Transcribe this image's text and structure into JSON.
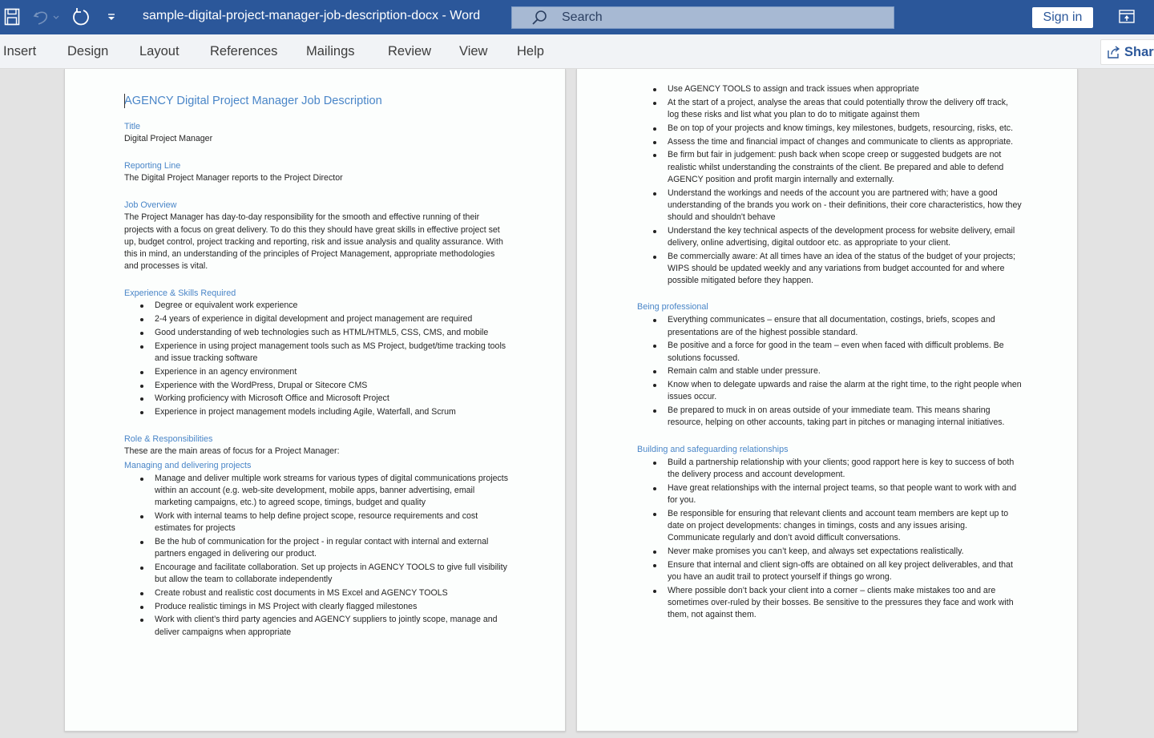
{
  "titlebar": {
    "document_title": "sample-digital-project-manager-job-description-docx  -  Word",
    "search_placeholder": "Search",
    "sign_in_label": "Sign in",
    "colors": {
      "titlebar": "#2b579a",
      "heading": "#4a86c8"
    }
  },
  "ribbon": {
    "tabs": [
      "Insert",
      "Design",
      "Layout",
      "References",
      "Mailings",
      "Review",
      "View",
      "Help"
    ],
    "share_label": "Share"
  },
  "document": {
    "title": "AGENCY Digital Project Manager Job Description",
    "title_section": {
      "heading": "Title",
      "text": "Digital Project Manager"
    },
    "reporting_line": {
      "heading": "Reporting Line",
      "text": "The Digital Project Manager reports to the Project Director"
    },
    "job_overview": {
      "heading": "Job Overview",
      "text": "The Project Manager has day-to-day responsibility for the smooth and effective running of their projects with a focus on great delivery. To do this they should have great skills in effective project set up, budget control, project tracking and reporting, risk and issue analysis and quality assurance. With this in mind, an understanding of the principles of Project Management, appropriate methodologies and processes is vital."
    },
    "experience": {
      "heading": "Experience & Skills Required",
      "items": [
        "Degree or equivalent work experience",
        "2-4 years of experience in digital development and project management are required",
        "Good understanding of web technologies such as HTML/HTML5, CSS, CMS, and mobile",
        "Experience in using project management tools such as MS Project, budget/time tracking tools and issue tracking software",
        "Experience in an agency environment",
        "Experience with the WordPress, Drupal or Sitecore CMS",
        "Working proficiency with Microsoft Office and Microsoft Project",
        "Experience in project management models including Agile, Waterfall, and Scrum"
      ]
    },
    "role": {
      "heading": "Role & Responsibilities",
      "intro": "These are the main areas of focus for a Project Manager:",
      "managing": {
        "heading": "Managing and delivering projects",
        "items": [
          "Manage and deliver multiple work streams for various types of digital communications projects within an account (e.g. web-site development, mobile apps, banner advertising, email marketing campaigns, etc.) to agreed scope, timings, budget and quality",
          "Work with internal teams to help define project scope, resource requirements and cost estimates for projects",
          "Be the hub of communication for the project - in regular contact with internal and external partners engaged in delivering our product.",
          "Encourage and facilitate collaboration. Set up projects in AGENCY TOOLS to give full visibility but allow the team to collaborate independently",
          "Create robust and realistic cost documents in MS Excel and AGENCY TOOLS",
          "Produce realistic timings in MS Project with clearly flagged milestones",
          "Work with client’s third party agencies and AGENCY suppliers to jointly scope, manage and deliver campaigns when appropriate"
        ],
        "items_continued": [
          "Use AGENCY TOOLS to assign and track issues when appropriate",
          "At the start of a project, analyse the areas that could potentially throw the delivery off track, log these risks and list what you plan to do to mitigate against them",
          "Be on top of your projects and know timings, key milestones, budgets, resourcing, risks, etc.",
          "Assess the time and financial impact of changes and communicate to clients as appropriate.",
          "Be firm but fair in judgement: push back when scope creep or suggested budgets are not realistic whilst understanding the constraints of the client. Be prepared and able to defend AGENCY position and profit margin internally and externally.",
          "Understand the workings and needs of the account you are partnered with; have a good understanding of the brands you work on - their definitions, their core characteristics, how they should and shouldn't behave",
          "Understand the key technical aspects of the development process for website delivery, email delivery, online advertising, digital outdoor etc. as appropriate to your client.",
          "Be commercially aware: At all times have an idea of the status of the budget of your projects; WIPS should be updated weekly and any variations from budget accounted for and where possible mitigated before they happen."
        ]
      },
      "professional": {
        "heading": "Being professional",
        "items": [
          "Everything communicates – ensure that all documentation, costings, briefs, scopes and presentations are of the highest possible standard.",
          "Be positive and a force for good in the team – even when faced with difficult problems. Be solutions focussed.",
          "Remain calm and stable under pressure.",
          "Know when to delegate upwards and raise the alarm at the right time, to the right people when issues occur.",
          "Be prepared to muck in on areas outside of your immediate team. This means sharing resource, helping on other accounts, taking part in pitches or managing internal initiatives."
        ]
      },
      "relationships": {
        "heading": "Building and safeguarding relationships",
        "items": [
          "Build a partnership relationship with your clients; good rapport here is key to success of both the delivery process and account development.",
          "Have great relationships with the internal project teams, so that people want to work with and for you.",
          "Be responsible for ensuring that relevant clients and account team members are kept up to date on project developments: changes in timings, costs and any issues arising. Communicate regularly and don’t avoid difficult conversations.",
          "Never make promises you can’t keep, and always set expectations realistically.",
          "Ensure that internal and client sign-offs are obtained on all key project deliverables, and that you have an audit trail to protect yourself if things go wrong.",
          "Where possible don’t back your client into a corner – clients make mistakes too and are sometimes over-ruled by their bosses. Be sensitive to the pressures they face and work with them, not against them."
        ]
      }
    }
  }
}
